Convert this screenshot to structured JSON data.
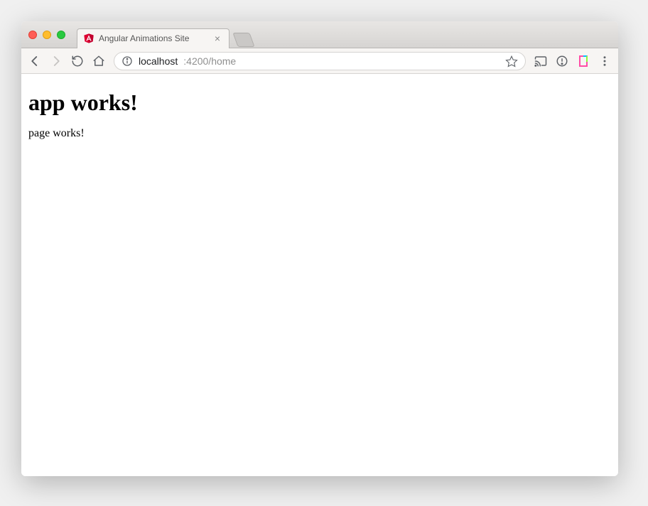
{
  "window": {
    "close_tooltip": "Close",
    "minimize_tooltip": "Minimize",
    "zoom_tooltip": "Zoom"
  },
  "tab": {
    "title": "Angular Animations Site"
  },
  "url": {
    "host": "localhost",
    "port_path": ":4200/home"
  },
  "page": {
    "heading": "app works!",
    "body": "page works!"
  }
}
